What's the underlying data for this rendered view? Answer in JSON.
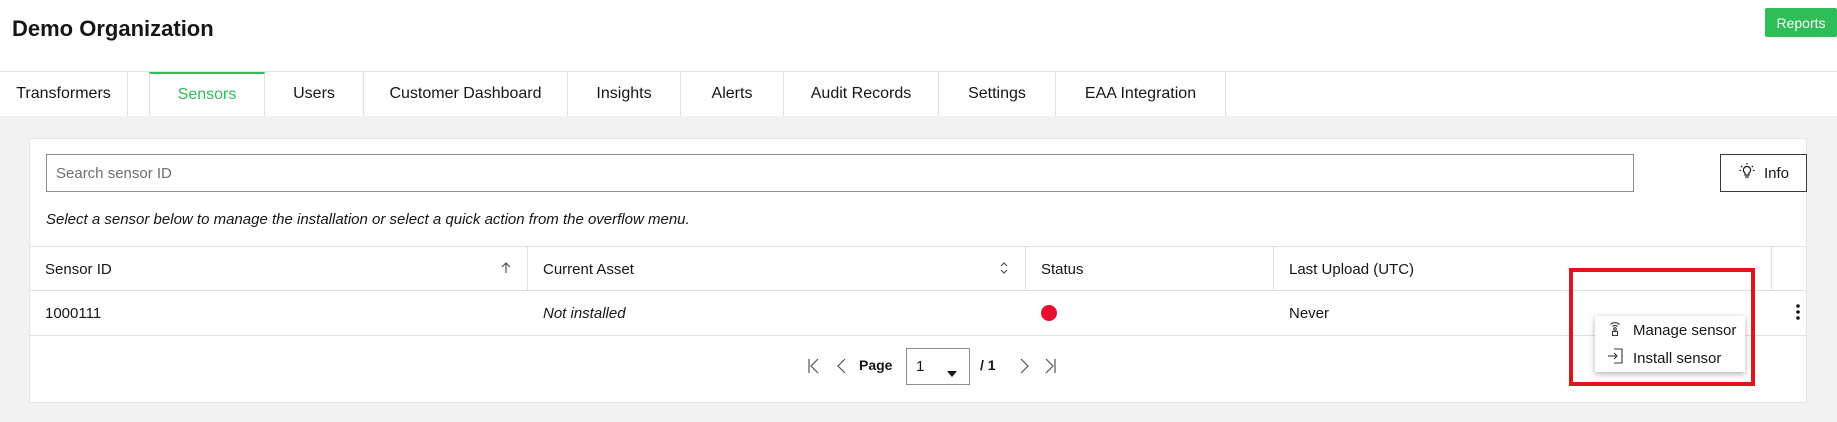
{
  "header": {
    "org_title": "Demo Organization",
    "reports_label": "Reports"
  },
  "tabs": [
    {
      "label": "Transformers",
      "active": false
    },
    {
      "label": "Sensors",
      "active": true
    },
    {
      "label": "Users",
      "active": false
    },
    {
      "label": "Customer Dashboard",
      "active": false
    },
    {
      "label": "Insights",
      "active": false
    },
    {
      "label": "Alerts",
      "active": false
    },
    {
      "label": "Audit Records",
      "active": false
    },
    {
      "label": "Settings",
      "active": false
    },
    {
      "label": "EAA Integration",
      "active": false
    }
  ],
  "search": {
    "placeholder": "Search sensor ID",
    "value": ""
  },
  "info_button": {
    "label": "Info",
    "icon": "lightbulb-icon"
  },
  "hint_text": "Select a sensor below to manage the installation or select a quick action from the overflow menu.",
  "table": {
    "columns": [
      {
        "label": "Sensor ID",
        "sort": "ascending"
      },
      {
        "label": "Current Asset",
        "sort": "sortable"
      },
      {
        "label": "Status",
        "sort": "none"
      },
      {
        "label": "Last Upload (UTC)",
        "sort": "none"
      }
    ],
    "rows": [
      {
        "sensor_id": "1000111",
        "current_asset": "Not installed",
        "status": "offline",
        "last_upload": "Never"
      }
    ]
  },
  "pagination": {
    "page_label": "Page",
    "current_page": "1",
    "total": "/ 1"
  },
  "overflow_menu": {
    "items": [
      {
        "label": "Manage sensor",
        "icon": "sensor-signal-icon"
      },
      {
        "label": "Install sensor",
        "icon": "install-icon"
      }
    ]
  },
  "colors": {
    "accent": "#2fbd57",
    "status_offline": "#e8112d",
    "highlight": "#e3131b"
  }
}
